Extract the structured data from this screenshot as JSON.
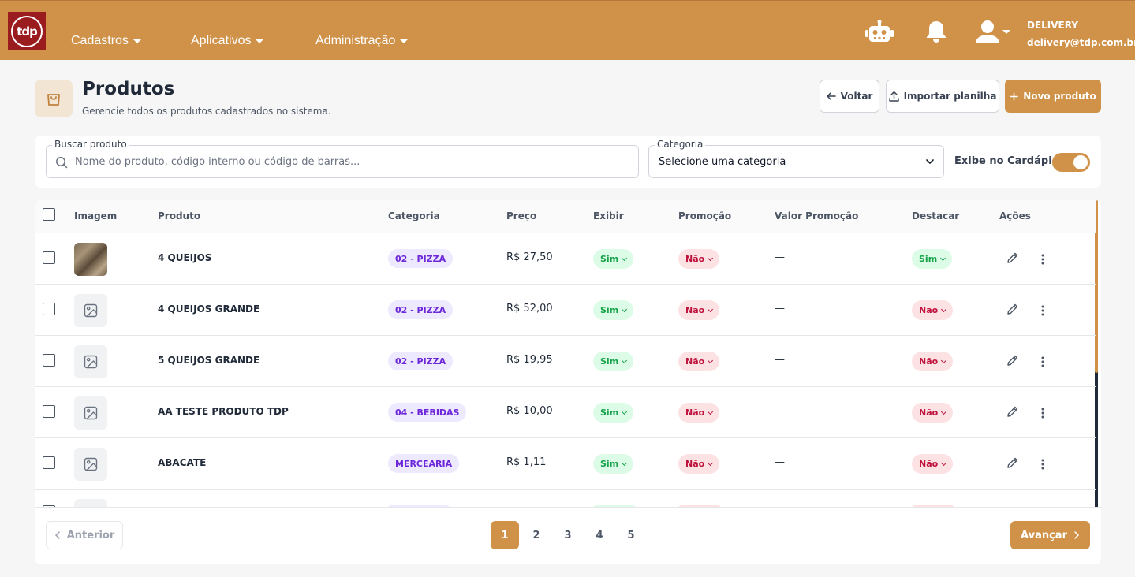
{
  "brand": {
    "logo_text": "tdp",
    "accent": "#d09249",
    "logo_bg": "#9b1c1f"
  },
  "nav": {
    "items": [
      {
        "label": "Cadastros"
      },
      {
        "label": "Aplicativos"
      },
      {
        "label": "Administração"
      }
    ]
  },
  "user": {
    "name": "DELIVERY",
    "email": "delivery@tdp.com.br"
  },
  "header": {
    "title": "Produtos",
    "subtitle": "Gerencie todos os produtos cadastrados no sistema.",
    "back_label": "Voltar",
    "import_label": "Importar planilha",
    "new_label": "Novo produto"
  },
  "filters": {
    "search_label": "Buscar produto",
    "search_placeholder": "Nome do produto, código interno ou código de barras...",
    "search_value": "",
    "category_label": "Categoria",
    "category_selected": "Selecione uma categoria",
    "toggle_label": "Exibe no Cardápio",
    "toggle_on": true
  },
  "table": {
    "columns": [
      "Imagem",
      "Produto",
      "Categoria",
      "Preço",
      "Exibir",
      "Promoção",
      "Valor Promoção",
      "Destacar",
      "Ações"
    ],
    "rows": [
      {
        "name": "4 QUEIJOS",
        "category": "02 - PIZZA",
        "price": "R$ 27,50",
        "exibir": "Sim",
        "promocao": "Não",
        "valor_promocao": "—",
        "destacar": "Sim",
        "has_image": true
      },
      {
        "name": "4 QUEIJOS GRANDE",
        "category": "02 - PIZZA",
        "price": "R$ 52,00",
        "exibir": "Sim",
        "promocao": "Não",
        "valor_promocao": "—",
        "destacar": "Não",
        "has_image": false
      },
      {
        "name": "5 QUEIJOS GRANDE",
        "category": "02 - PIZZA",
        "price": "R$ 19,95",
        "exibir": "Sim",
        "promocao": "Não",
        "valor_promocao": "—",
        "destacar": "Não",
        "has_image": false
      },
      {
        "name": "AA TESTE PRODUTO TDP",
        "category": "04 - BEBIDAS",
        "price": "R$ 10,00",
        "exibir": "Sim",
        "promocao": "Não",
        "valor_promocao": "—",
        "destacar": "Não",
        "has_image": false
      },
      {
        "name": "ABACATE",
        "category": "MERCEARIA",
        "price": "R$ 1,11",
        "exibir": "Sim",
        "promocao": "Não",
        "valor_promocao": "—",
        "destacar": "Não",
        "has_image": false
      }
    ]
  },
  "pagination": {
    "prev_label": "Anterior",
    "next_label": "Avançar",
    "pages": [
      "1",
      "2",
      "3",
      "4",
      "5"
    ],
    "current": "1"
  },
  "icons": {
    "robot": "robot-icon",
    "bell": "bell-icon",
    "user": "user-icon",
    "bag": "shopping-bag-icon",
    "image": "image-placeholder-icon",
    "edit": "pencil-icon",
    "more": "kebab-menu-icon"
  }
}
